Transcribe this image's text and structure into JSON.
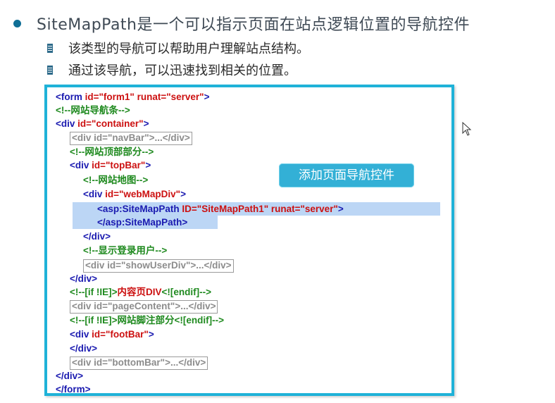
{
  "slide": {
    "title": "SiteMapPath是一个可以指示页面在站点逻辑位置的导航控件",
    "points": [
      "该类型的导航可以帮助用户理解站点结构。",
      "通过该导航，可以迅速找到相关的位置。"
    ]
  },
  "code_box": {
    "callout": "添加页面导航控件",
    "lines": {
      "l1": {
        "t1": "<form ",
        "a1": "id=\"form1\" ",
        "a2": "runat=\"server\"",
        "t2": ">"
      },
      "l2": {
        "c": "<!--网站导航条-->"
      },
      "l3": {
        "t1": "<div ",
        "a1": "id=\"container\"",
        "t2": ">"
      },
      "l4": {
        "box": "<div id=\"navBar\">...</div>"
      },
      "l5": {
        "c": "<!--网站顶部部分-->"
      },
      "l6": {
        "t1": "<div ",
        "a1": "id=\"topBar\"",
        "t2": ">"
      },
      "l7": {
        "c": "<!--网站地图-->"
      },
      "l8": {
        "t1": "<div ",
        "a1": "id=\"webMapDiv\"",
        "t2": ">"
      },
      "l9": {
        "t1": "<asp:SiteMapPath ",
        "a1": "ID=\"SiteMapPath1\" ",
        "a2": "runat=\"server\"",
        "t2": ">"
      },
      "l10": {
        "t1": "</asp:SiteMapPath>"
      },
      "l11": {
        "t1": "</div>"
      },
      "l12": {
        "c": "<!--显示登录用户-->"
      },
      "l13": {
        "box": "<div id=\"showUserDiv\">...</div>"
      },
      "l14": {
        "t1": "</div>"
      },
      "l15": {
        "c1": "<!--[if !IE]>",
        "c2": "内容页DIV",
        "c3": "<![endif]-->"
      },
      "l16": {
        "box": "<div id=\"pageContent\">...</div>"
      },
      "l17": {
        "c1": "<!--[if !IE]>",
        "c2": "网站脚注部分",
        "c3": "<![endif]-->"
      },
      "l18": {
        "t1": "<div ",
        "a1": "id=\"footBar\"",
        "t2": ">"
      },
      "l19": {
        "t1": "</div>"
      },
      "l20": {
        "box": "<div id=\"bottomBar\">...</div>"
      },
      "l21": {
        "t1": "</div>"
      },
      "l22": {
        "t1": "</form>"
      }
    }
  },
  "colors": {
    "accent": "#1fb2d8",
    "tag": "#1a1ab0",
    "attribute": "#cc1010",
    "comment": "#1f8a1f",
    "highlight": "#bcd6f5"
  },
  "icons": {
    "bullet": "filled-circle",
    "sub_bullet": "striped-square",
    "cursor": "mouse-pointer-icon"
  }
}
